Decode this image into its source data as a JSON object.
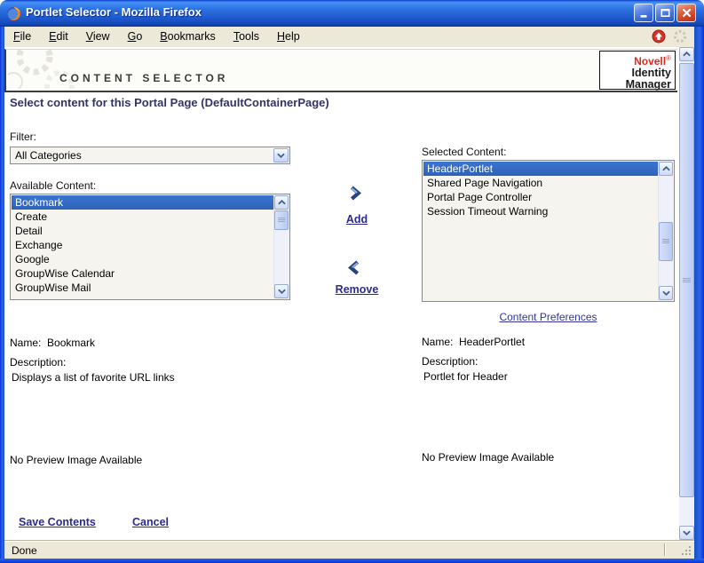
{
  "window": {
    "title": "Portlet Selector - Mozilla Firefox",
    "status": "Done"
  },
  "menu": {
    "items": [
      {
        "key": "F",
        "rest": "ile"
      },
      {
        "key": "E",
        "rest": "dit"
      },
      {
        "key": "V",
        "rest": "iew"
      },
      {
        "key": "G",
        "rest": "o"
      },
      {
        "key": "B",
        "rest": "ookmarks"
      },
      {
        "key": "T",
        "rest": "ools"
      },
      {
        "key": "H",
        "rest": "elp"
      }
    ]
  },
  "header": {
    "title": "CONTENT SELECTOR",
    "brand": {
      "name": "Novell",
      "reg": "®",
      "line2": "Identity",
      "line3": "Manager"
    }
  },
  "page": {
    "heading": "Select content for this Portal Page (DefaultContainerPage)",
    "filter": {
      "label": "Filter:",
      "value": "All Categories"
    },
    "available": {
      "label": "Available Content:",
      "items": [
        "Bookmark",
        "Create",
        "Detail",
        "Exchange",
        "Google",
        "GroupWise Calendar",
        "GroupWise Mail"
      ],
      "selected_index": 0
    },
    "selected": {
      "label": "Selected Content:",
      "items": [
        "HeaderPortlet",
        "Shared Page Navigation",
        "Portal Page Controller",
        "Session Timeout Warning"
      ],
      "selected_index": 0
    },
    "actions": {
      "add": "Add",
      "remove": "Remove"
    },
    "content_preferences": "Content Preferences",
    "left_detail": {
      "name_label": "Name:",
      "name": "Bookmark",
      "description_label": "Description:",
      "description": "Displays a list of favorite URL links",
      "no_preview": "No Preview Image Available"
    },
    "right_detail": {
      "name_label": "Name:",
      "name": "HeaderPortlet",
      "description_label": "Description:",
      "description": "Portlet for Header",
      "no_preview": "No Preview Image Available"
    },
    "footer": {
      "save": "Save Contents",
      "cancel": "Cancel"
    }
  },
  "colors": {
    "titlebar_blue": "#2b71e0",
    "menubar_beige": "#ece9d8",
    "selection_blue": "#316ac5",
    "heading_navy": "#333366",
    "link_navy": "#2b2b8f",
    "novell_red": "#dc2a1e",
    "close_red": "#d04426"
  }
}
